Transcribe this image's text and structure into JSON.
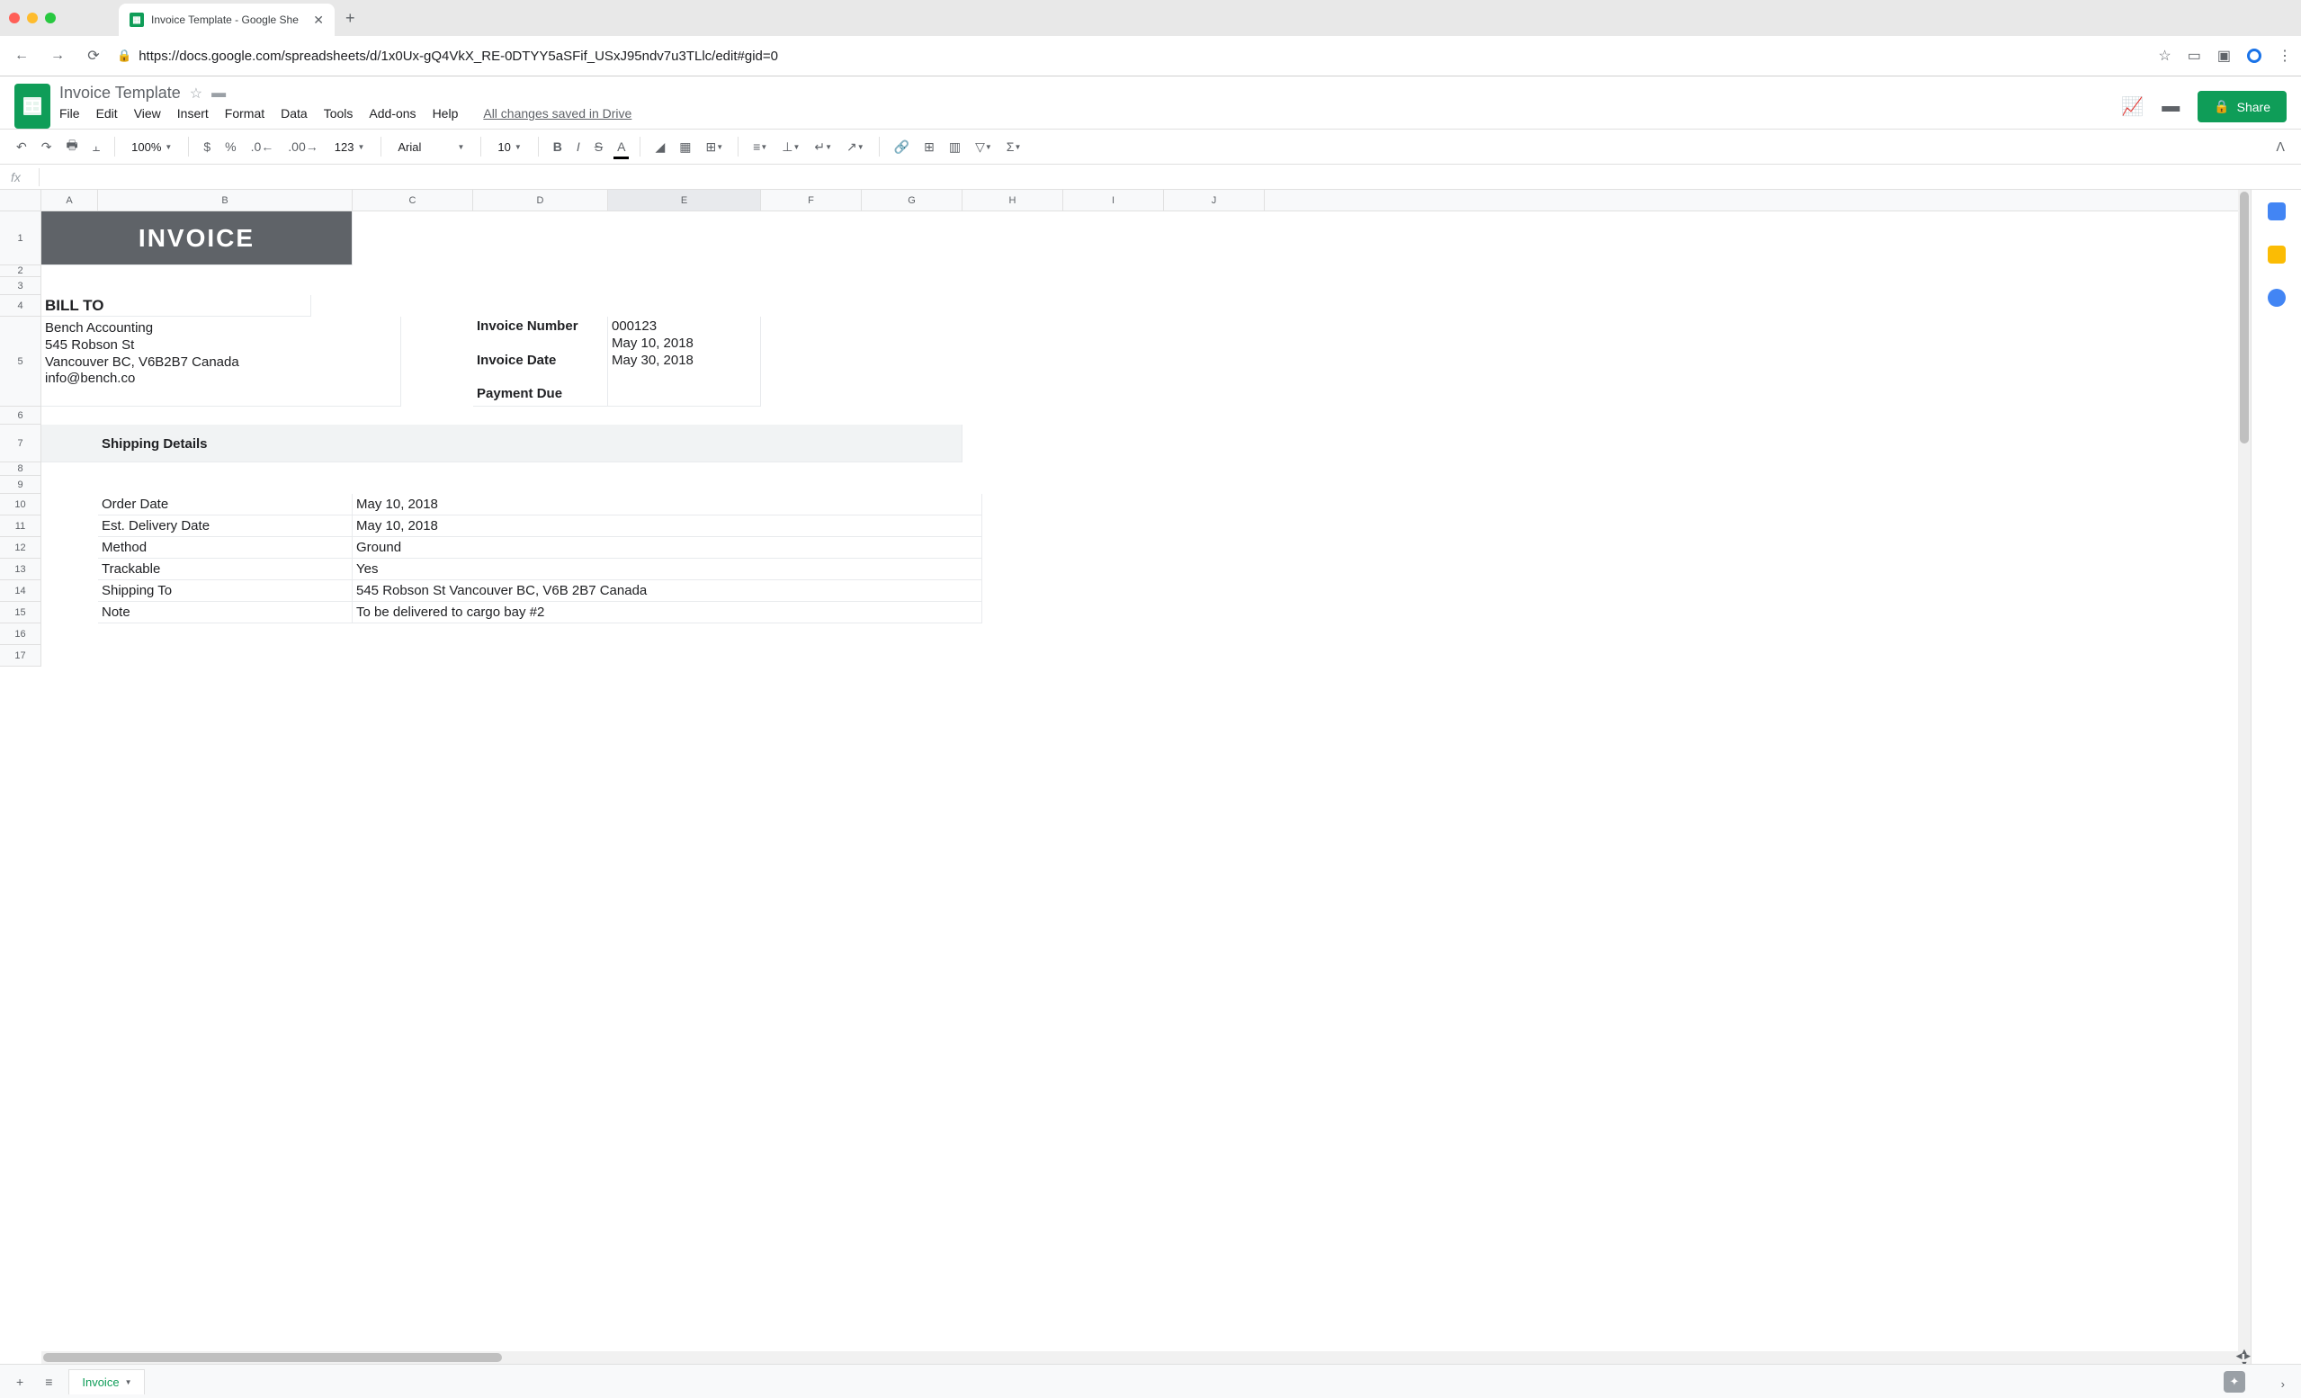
{
  "browser": {
    "tab_title": "Invoice Template - Google She",
    "url": "https://docs.google.com/spreadsheets/d/1x0Ux-gQ4VkX_RE-0DTYY5aSFif_USxJ95ndv7u3TLlc/edit#gid=0"
  },
  "doc": {
    "title": "Invoice Template",
    "save_status": "All changes saved in Drive",
    "menus": [
      "File",
      "Edit",
      "View",
      "Insert",
      "Format",
      "Data",
      "Tools",
      "Add-ons",
      "Help"
    ],
    "share_label": "Share"
  },
  "toolbar": {
    "zoom": "100%",
    "font": "Arial",
    "font_size": "10",
    "number_format": "123"
  },
  "columns": [
    "A",
    "B",
    "C",
    "D",
    "E",
    "F",
    "G",
    "H",
    "I",
    "J"
  ],
  "col_widths": {
    "A": 63,
    "B": 283,
    "C": 134,
    "D": 150,
    "E": 170,
    "F": 112,
    "G": 112,
    "H": 112,
    "I": 112,
    "J": 112
  },
  "row_heights": {
    "1": 60,
    "2": 13,
    "3": 20,
    "4": 24,
    "5": 100,
    "6": 20,
    "7": 42,
    "8": 15,
    "9": 20,
    "10": 24,
    "11": 24,
    "12": 24,
    "13": 24,
    "14": 24,
    "15": 24,
    "16": 24,
    "17": 24
  },
  "selected_col": "E",
  "invoice": {
    "header": "INVOICE",
    "bill_to_label": "BILL TO",
    "bill_to_text": "Bench Accounting\n545 Robson St\nVancouver BC, V6B2B7 Canada\ninfo@bench.co",
    "number_label": "Invoice Number",
    "number_value": "000123",
    "date_label": "Invoice Date",
    "date_value": "May 10, 2018",
    "due_label": "Payment Due",
    "due_value": "May 30, 2018",
    "shipping_header": "Shipping Details",
    "shipping": [
      {
        "label": "Order Date",
        "value": "May 10, 2018"
      },
      {
        "label": "Est. Delivery Date",
        "value": "May 10, 2018"
      },
      {
        "label": "Method",
        "value": "Ground"
      },
      {
        "label": "Trackable",
        "value": "Yes"
      },
      {
        "label": "Shipping To",
        "value": "545 Robson St Vancouver BC, V6B 2B7 Canada"
      },
      {
        "label": "Note",
        "value": "To be delivered to cargo bay #2"
      }
    ]
  },
  "sheet_tab": "Invoice"
}
